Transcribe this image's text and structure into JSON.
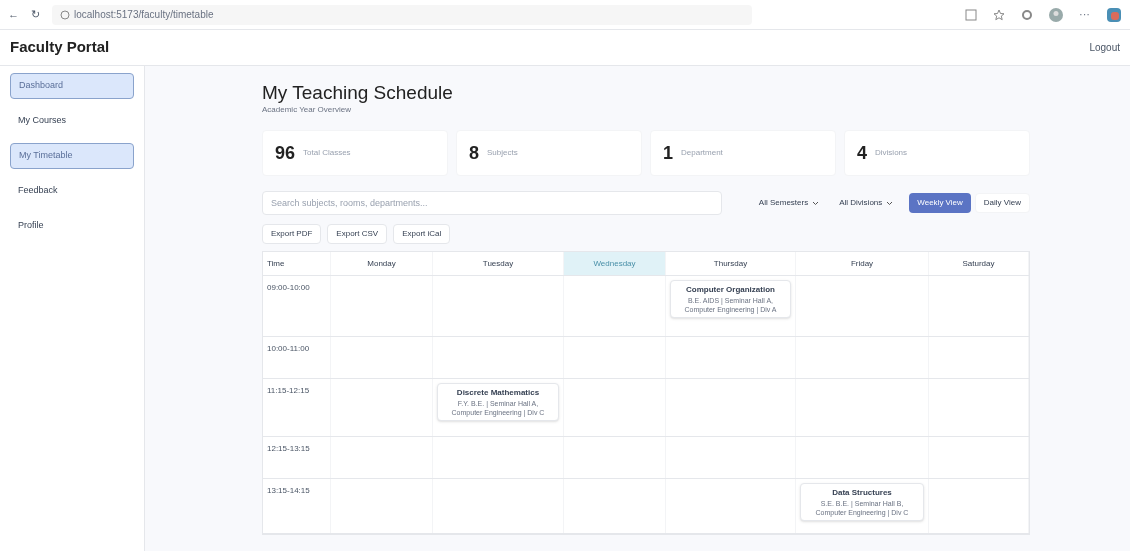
{
  "browser": {
    "back": "←",
    "reload": "↻",
    "url": "localhost:5173/faculty/timetable",
    "more": "···"
  },
  "header": {
    "title": "Faculty Portal",
    "logout": "Logout"
  },
  "sidebar": {
    "items": [
      {
        "label": "Dashboard",
        "selected": true
      },
      {
        "label": "My Courses",
        "selected": false
      },
      {
        "label": "My Timetable",
        "selected": true
      },
      {
        "label": "Feedback",
        "selected": false
      },
      {
        "label": "Profile",
        "selected": false
      }
    ]
  },
  "page": {
    "title": "My Teaching Schedule",
    "subtitle": "Academic Year Overview"
  },
  "stats": [
    {
      "value": "96",
      "label": "Total Classes"
    },
    {
      "value": "8",
      "label": "Subjects"
    },
    {
      "value": "1",
      "label": "Department"
    },
    {
      "value": "4",
      "label": "Divisions"
    }
  ],
  "filters": {
    "search": {
      "placeholder": "Search subjects, rooms, departments..."
    },
    "dropdowns": [
      "All Semesters",
      "All Divisions"
    ],
    "views": [
      {
        "label": "Weekly View",
        "selected": true
      },
      {
        "label": "Daily View",
        "selected": false
      }
    ]
  },
  "exports": [
    "Export PDF",
    "Export CSV",
    "Export iCal"
  ],
  "timetable": {
    "time_header": "Time",
    "days": [
      {
        "label": "Monday",
        "today": false
      },
      {
        "label": "Tuesday",
        "today": false
      },
      {
        "label": "Wednesday",
        "today": true
      },
      {
        "label": "Thursday",
        "today": false
      },
      {
        "label": "Friday",
        "today": false
      },
      {
        "label": "Saturday",
        "today": false
      }
    ],
    "rows": [
      {
        "time": "09:00-10:00",
        "cells": [
          {
            "kind": "empty"
          },
          {
            "kind": "empty"
          },
          {
            "kind": "empty"
          },
          {
            "kind": "class",
            "subject": "Computer Organization",
            "detail": "B.E. AIDS | Seminar Hall A, Computer Engineering | Div A"
          },
          {
            "kind": "empty"
          },
          {
            "kind": "empty"
          }
        ]
      },
      {
        "time": "10:00-11:00",
        "cells": [
          {
            "kind": "empty"
          },
          {
            "kind": "empty"
          },
          {
            "kind": "empty"
          },
          {
            "kind": "empty"
          },
          {
            "kind": "empty"
          },
          {
            "kind": "empty"
          }
        ]
      },
      {
        "time": "11:15-12:15",
        "cells": [
          {
            "kind": "empty"
          },
          {
            "kind": "class",
            "subject": "Discrete Mathematics",
            "detail": "F.Y. B.E. | Seminar Hall A, Computer Engineering | Div C"
          },
          {
            "kind": "empty"
          },
          {
            "kind": "empty"
          },
          {
            "kind": "empty"
          },
          {
            "kind": "empty"
          }
        ]
      },
      {
        "time": "12:15-13:15",
        "cells": [
          {
            "kind": "empty"
          },
          {
            "kind": "empty"
          },
          {
            "kind": "empty"
          },
          {
            "kind": "empty"
          },
          {
            "kind": "empty"
          },
          {
            "kind": "empty"
          }
        ]
      },
      {
        "time": "13:15-14:15",
        "cells": [
          {
            "kind": "empty"
          },
          {
            "kind": "empty"
          },
          {
            "kind": "empty"
          },
          {
            "kind": "empty"
          },
          {
            "kind": "class",
            "subject": "Data Structures",
            "detail": "S.E. B.E. | Seminar Hall B, Computer Engineering | Div C"
          },
          {
            "kind": "empty"
          }
        ]
      }
    ]
  }
}
